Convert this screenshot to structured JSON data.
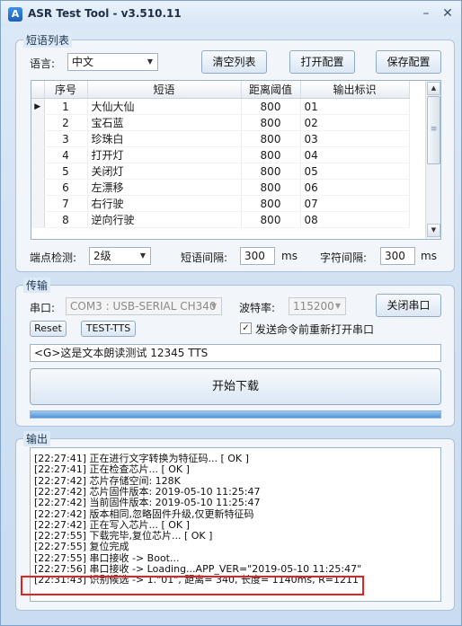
{
  "window": {
    "title": "ASR Test Tool  -  v3.510.11",
    "minimize_glyph": "–",
    "close_glyph": "✕",
    "icon_glyph": "A"
  },
  "phrase_group": {
    "title": "短语列表",
    "language_label": "语言:",
    "language_value": "中文",
    "clear_button": "清空列表",
    "open_button": "打开配置",
    "save_button": "保存配置",
    "table": {
      "headers": [
        "序号",
        "短语",
        "距离阈值",
        "输出标识"
      ],
      "rows": [
        {
          "index": "1",
          "phrase": "大仙大仙",
          "threshold": "800",
          "output_id": "01"
        },
        {
          "index": "2",
          "phrase": "宝石蓝",
          "threshold": "800",
          "output_id": "02"
        },
        {
          "index": "3",
          "phrase": "珍珠白",
          "threshold": "800",
          "output_id": "03"
        },
        {
          "index": "4",
          "phrase": "打开灯",
          "threshold": "800",
          "output_id": "04"
        },
        {
          "index": "5",
          "phrase": "关闭灯",
          "threshold": "800",
          "output_id": "05"
        },
        {
          "index": "6",
          "phrase": "左漂移",
          "threshold": "800",
          "output_id": "06"
        },
        {
          "index": "7",
          "phrase": "右行驶",
          "threshold": "800",
          "output_id": "07"
        },
        {
          "index": "8",
          "phrase": "逆向行驶",
          "threshold": "800",
          "output_id": "08"
        }
      ]
    },
    "endpoint_label": "端点检测:",
    "endpoint_value": "2级",
    "phrase_gap_label": "短语间隔:",
    "phrase_gap_value": "300",
    "phrase_gap_unit": "ms",
    "char_gap_label": "字符间隔:",
    "char_gap_value": "300",
    "char_gap_unit": "ms"
  },
  "transfer_group": {
    "title": "传输",
    "port_label": "串口:",
    "port_value": "COM3 : USB-SERIAL CH340",
    "baud_label": "波特率:",
    "baud_value": "115200",
    "close_port_button": "关闭串口",
    "reset_button": "Reset",
    "tts_button": "TEST-TTS",
    "reopen_checkbox_label": "发送命令前重新打开串口",
    "reopen_checked": true,
    "tts_text": "<G>这是文本朗读测试 12345 TTS",
    "download_button": "开始下载",
    "progress": 1.0
  },
  "output_group": {
    "title": "输出",
    "lines": [
      "[22:27:41] 正在进行文字转换为特征码... [ OK ]",
      "[22:27:41] 正在检查芯片... [ OK ]",
      "[22:27:42] 芯片存储空间: 128K",
      "[22:27:42] 芯片固件版本: 2019-05-10 11:25:47",
      "[22:27:42] 当前固件版本: 2019-05-10 11:25:47",
      "[22:27:42] 版本相同,忽略固件升级,仅更新特征码",
      "[22:27:42] 正在写入芯片... [ OK ]",
      "[22:27:55] 下载完毕,复位芯片... [ OK ]",
      "[22:27:55] 复位完成",
      "[22:27:55] 串口接收 -> Boot...",
      "[22:27:56] 串口接收 -> Loading...APP_VER=\"2019-05-10 11:25:47\"",
      "[22:31:43] 识别候选 -> 1.\"01\", 距离= 340, 长度= 1140ms, R=1211"
    ],
    "highlight_color": "#e52020"
  }
}
